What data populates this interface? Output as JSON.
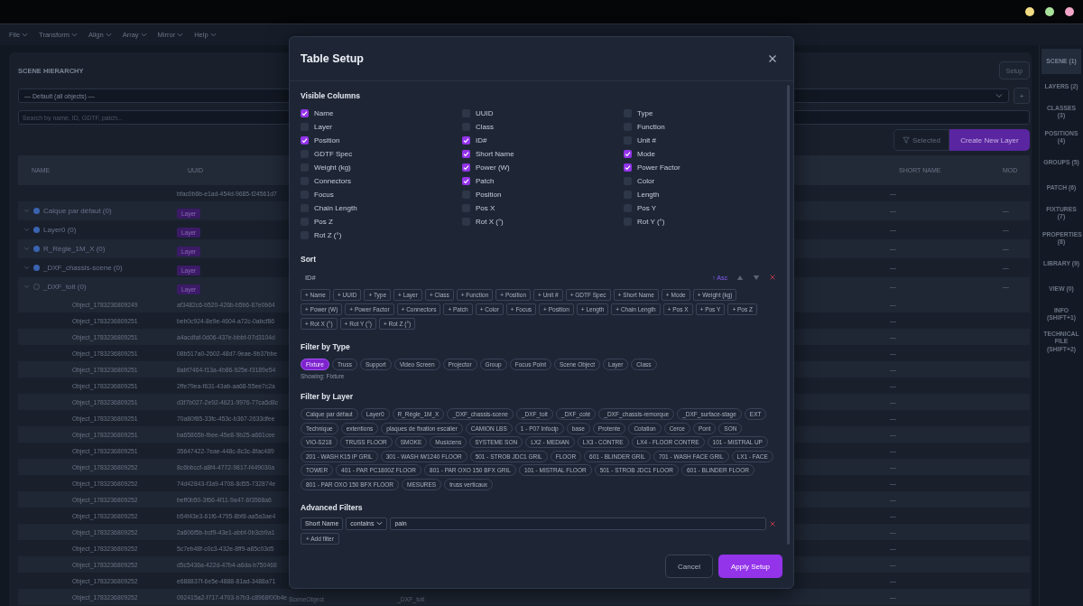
{
  "titlebar": {
    "lights": [
      {
        "color": "#f2dc83"
      },
      {
        "color": "#a9e29a"
      },
      {
        "color": "#f3a6c8"
      }
    ]
  },
  "menu": [
    "File",
    "Transform",
    "Align",
    "Array",
    "Mirror",
    "Help"
  ],
  "scene": {
    "title": "SCENE HIERARCHY",
    "setup_button": "Setup",
    "layer_select": "— Default (all objects) —",
    "add_button": "+",
    "search": {
      "placeholder": "Search by name, ID, GDTF, patch..."
    },
    "selected_button": "Selected",
    "create_button": "Create New Layer",
    "table": {
      "columns": [
        "NAME",
        "UUID",
        "SHORT NAME",
        "MOD"
      ],
      "rows": [
        {
          "kind": "blank",
          "uuid": "bfac0b6b-e1ad-454d-9685-f24561d7",
          "short_name": "—"
        },
        {
          "kind": "layer",
          "name": "Calque par défaut (0)",
          "tag": "Layer",
          "visible": true,
          "short_name": "—",
          "mode": "—"
        },
        {
          "kind": "layer",
          "name": "Layer0 (0)",
          "tag": "Layer",
          "visible": true,
          "short_name": "—",
          "mode": "—"
        },
        {
          "kind": "layer",
          "name": "R_Règle_1M_X (0)",
          "tag": "Layer",
          "visible": true,
          "short_name": "—",
          "mode": "—"
        },
        {
          "kind": "layer",
          "name": "_DXF_chassis-scene (0)",
          "tag": "Layer",
          "visible": true,
          "short_name": "—",
          "mode": "—"
        },
        {
          "kind": "layer",
          "name": "_DXF_toit (0)",
          "tag": "Layer",
          "visible": false,
          "short_name": "—",
          "mode": "—"
        },
        {
          "kind": "object",
          "name": "Object_1783236809249",
          "uuid": "af3482c6-b520-426b-b5b6-67e0b64",
          "short_name": "—"
        },
        {
          "kind": "object",
          "name": "Object_1783236809251",
          "uuid": "beb0c924-8e9e-4604-a72c-0abcf86",
          "short_name": "—"
        },
        {
          "kind": "object",
          "name": "Object_1783236809251",
          "uuid": "a4acdfaf-0d06-437e-bbbf-07d3104d",
          "short_name": "—"
        },
        {
          "kind": "object",
          "name": "Object_1783236809251",
          "uuid": "08b517a0-2602-48d7-9eae-9b37bbe",
          "short_name": "—"
        },
        {
          "kind": "object",
          "name": "Object_1783236809251",
          "uuid": "8abf7464-f13a-4b86-925e-f3189e54",
          "short_name": "—"
        },
        {
          "kind": "object",
          "name": "Object_1783236809251",
          "uuid": "2ffe79ea-f631-43ab-aa68-55ee7c2a",
          "short_name": "—"
        },
        {
          "kind": "object",
          "name": "Object_1783236809251",
          "uuid": "d3f7b027-2e92-4621-9976-77ca5d8c",
          "short_name": "—"
        },
        {
          "kind": "object",
          "name": "Object_1783236809251",
          "uuid": "70a80f85-33fc-453c-b367-2633dfee",
          "short_name": "—"
        },
        {
          "kind": "object",
          "name": "Object_1783236809251",
          "uuid": "ba65865b-fbee-45e8-9b25-a661cee",
          "short_name": "—"
        },
        {
          "kind": "object",
          "name": "Object_1783236809251",
          "uuid": "35647422-7eae-448c-8c3c-8fac489",
          "short_name": "—"
        },
        {
          "kind": "object",
          "name": "Object_1783236809252",
          "uuid": "8c6bbccf-a8f4-4772-9817-f449030a",
          "short_name": "—"
        },
        {
          "kind": "object",
          "name": "Object_1783236809252",
          "uuid": "74d42843-f3a9-4708-8d55-732874e",
          "short_name": "—"
        },
        {
          "kind": "object",
          "name": "Object_1783236809252",
          "uuid": "beff0b50-3f66-4f11-9a47-6f3568a6",
          "short_name": "—"
        },
        {
          "kind": "object",
          "name": "Object_1783236809252",
          "uuid": "b54f43e3-61f6-4795-8bf8-aa5a3ae4",
          "short_name": "—"
        },
        {
          "kind": "object",
          "name": "Object_1783236809252",
          "uuid": "2a606f5b-bcf9-43e1-abbf-0b3cb9a1",
          "short_name": "—"
        },
        {
          "kind": "object",
          "name": "Object_1783236809252",
          "uuid": "5c7eb48f-c0c3-432e-8ff9-a85c03d5",
          "short_name": "—"
        },
        {
          "kind": "object",
          "name": "Object_1783236809252",
          "uuid": "d5c5436a-422d-47b4-a6da-b750468",
          "short_name": "—"
        },
        {
          "kind": "object",
          "name": "Object_1783236809252",
          "uuid": "e688837f-6e5e-4888-81ad-3488a71",
          "short_name": "—"
        },
        {
          "kind": "object",
          "name": "Object_1783236809252",
          "uuid": "092415a2-f717-4703-b7b3-c8968f00b4e",
          "type": "SceneObject",
          "layer": "_DXF_toit",
          "short_name": "—"
        }
      ]
    }
  },
  "sidebar": [
    {
      "label": "SCENE (1)",
      "selected": true
    },
    {
      "label": "LAYERS (2)",
      "selected": false
    },
    {
      "label": "CLASSES (3)",
      "selected": false
    },
    {
      "label": "POSITIONS (4)",
      "selected": false
    },
    {
      "label": "GROUPS (5)",
      "selected": false
    },
    {
      "label": "PATCH (6)",
      "selected": false
    },
    {
      "label": "FIXTURES (7)",
      "selected": false
    },
    {
      "label": "PROPERTIES (8)",
      "selected": false
    },
    {
      "label": "LIBRARY (9)",
      "selected": false
    },
    {
      "label": "VIEW (0)",
      "selected": false
    },
    {
      "label": "INFO (SHIFT+1)",
      "selected": false
    },
    {
      "label": "TECHNICAL FILE (SHIFT+2)",
      "selected": false
    }
  ],
  "dialog": {
    "title": "Table Setup",
    "visible_columns": {
      "heading": "Visible Columns",
      "items": [
        {
          "label": "Name",
          "checked": true
        },
        {
          "label": "UUID",
          "checked": false
        },
        {
          "label": "Type",
          "checked": false
        },
        {
          "label": "Layer",
          "checked": false
        },
        {
          "label": "Class",
          "checked": false
        },
        {
          "label": "Function",
          "checked": false
        },
        {
          "label": "Position",
          "checked": true
        },
        {
          "label": "ID#",
          "checked": true
        },
        {
          "label": "Unit #",
          "checked": false
        },
        {
          "label": "GDTF Spec",
          "checked": false
        },
        {
          "label": "Short Name",
          "checked": true
        },
        {
          "label": "Mode",
          "checked": true
        },
        {
          "label": "Weight (kg)",
          "checked": false
        },
        {
          "label": "Power (W)",
          "checked": true
        },
        {
          "label": "Power Factor",
          "checked": true
        },
        {
          "label": "Connectors",
          "checked": false
        },
        {
          "label": "Patch",
          "checked": true
        },
        {
          "label": "Color",
          "checked": false
        },
        {
          "label": "Focus",
          "checked": false
        },
        {
          "label": "Position",
          "checked": false
        },
        {
          "label": "Length",
          "checked": false
        },
        {
          "label": "Chain Length",
          "checked": false
        },
        {
          "label": "Pos X",
          "checked": false
        },
        {
          "label": "Pos Y",
          "checked": false
        },
        {
          "label": "Pos Z",
          "checked": false
        },
        {
          "label": "Rot X (°)",
          "checked": false
        },
        {
          "label": "Rot Y (°)",
          "checked": false
        },
        {
          "label": "Rot Z (°)",
          "checked": false
        }
      ]
    },
    "sort": {
      "heading": "Sort",
      "field": "ID#",
      "direction": "↑ Asc",
      "chips": [
        "+ Name",
        "+ UUID",
        "+ Type",
        "+ Layer",
        "+ Class",
        "+ Function",
        "+ Position",
        "+ Unit #",
        "+ GDTF Spec",
        "+ Short Name",
        "+ Mode",
        "+ Weight (kg)",
        "+ Power (W)",
        "+ Power Factor",
        "+ Connectors",
        "+ Patch",
        "+ Color",
        "+ Focus",
        "+ Position",
        "+ Length",
        "+ Chain Length",
        "+ Pos X",
        "+ Pos Y",
        "+ Pos Z",
        "+ Rot X (°)",
        "+ Rot Y (°)",
        "+ Rot Z (°)"
      ]
    },
    "type_filter": {
      "heading": "Filter by Type",
      "types": [
        {
          "label": "Fixture",
          "selected": true
        },
        {
          "label": "Truss",
          "selected": false
        },
        {
          "label": "Support",
          "selected": false
        },
        {
          "label": "Video Screen",
          "selected": false
        },
        {
          "label": "Projector",
          "selected": false
        },
        {
          "label": "Group",
          "selected": false
        },
        {
          "label": "Focus Point",
          "selected": false
        },
        {
          "label": "Scene Object",
          "selected": false
        },
        {
          "label": "Layer",
          "selected": false
        },
        {
          "label": "Class",
          "selected": false
        }
      ],
      "status": "Showing: Fixture"
    },
    "layer_filter": {
      "heading": "Filter by Layer",
      "layers": [
        "Calque par défaut",
        "Layer0",
        "R_Règle_1M_X",
        "_DXF_chassis-scene",
        "_DXF_toit",
        "_DXF_coté",
        "_DXF_chassis-remorque",
        "_DXF_surface-stage",
        "EXT",
        "Technique",
        "extentions",
        "plaques de fixation escalier",
        "CAMION LBS",
        "1 - P07 Infocip",
        "base",
        "Protente",
        "Cotation",
        "Cerce",
        "Pont",
        "SON",
        "VIO-S218",
        "TRUSS FLOOR",
        "SMOKE",
        "Musiciens",
        "SYSTEME SON",
        "LX2 - MEDIAN",
        "LX3 - CONTRE",
        "LX4 - FLOOR CONTRE",
        "101 - MISTRAL UP",
        "201 - WASH K15 iP GRIL",
        "301 - WASH iW1240 FLOOR",
        "501 - STROB JDC1 GRIL",
        "FLOOR",
        "601 - BLINDER GRIL",
        "701 - WASH FACE GRIL",
        "LX1 - FACE",
        "TOWER",
        "401 - PAR PC1800Z FLOOR",
        "801 - PAR OXO 150 BFX GRIL",
        "101 - MISTRAL FLOOR",
        "501 - STROB JDC1 FLOOR",
        "601 - BLINDER FLOOR",
        "801 - PAR OXO 150 BFX FLOOR",
        "MESURES",
        "truss verticaux"
      ]
    },
    "advanced_filters": {
      "heading": "Advanced Filters",
      "rules": [
        {
          "field": "Short Name",
          "operator": "contains",
          "value": "pain"
        }
      ],
      "add_button": "+ Add filter"
    },
    "buttons": {
      "cancel": "Cancel",
      "apply": "Apply Setup"
    }
  }
}
